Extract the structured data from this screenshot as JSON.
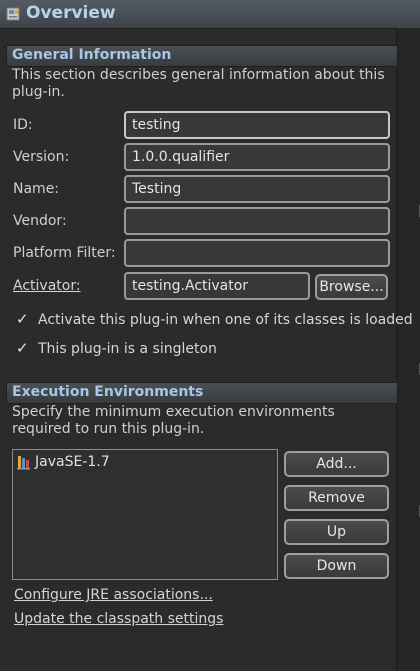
{
  "editor": {
    "title": "Overview"
  },
  "general": {
    "header": "General Information",
    "description": "This section describes general information about this plug-in.",
    "id_label": "ID:",
    "id_value": "testing",
    "version_label": "Version:",
    "version_value": "1.0.0.qualifier",
    "name_label": "Name:",
    "name_value": "Testing",
    "vendor_label": "Vendor:",
    "vendor_value": "",
    "platform_filter_label": "Platform Filter:",
    "platform_filter_value": "",
    "activator_label": "Activator:",
    "activator_value": "testing.Activator",
    "browse_label": "Browse...",
    "activate_check_label": "Activate this plug-in when one of its classes is loaded",
    "activate_checked": true,
    "singleton_check_label": "This plug-in is a singleton",
    "singleton_checked": true
  },
  "execution": {
    "header": "Execution Environments",
    "description": "Specify the minimum execution environments required to run this plug-in.",
    "environments": [
      "JavaSE-1.7"
    ],
    "add_label": "Add...",
    "remove_label": "Remove",
    "up_label": "Up",
    "down_label": "Down",
    "configure_link": "Configure JRE associations...",
    "update_link": "Update the classpath settings"
  },
  "icons": {
    "title": "plugin-manifest-icon",
    "environment": "jre-library-icon",
    "check": "checkmark-icon"
  },
  "colors": {
    "background": "#2b2b2b",
    "header_text": "#a9c6e6",
    "title_text": "#b9d3ef"
  }
}
